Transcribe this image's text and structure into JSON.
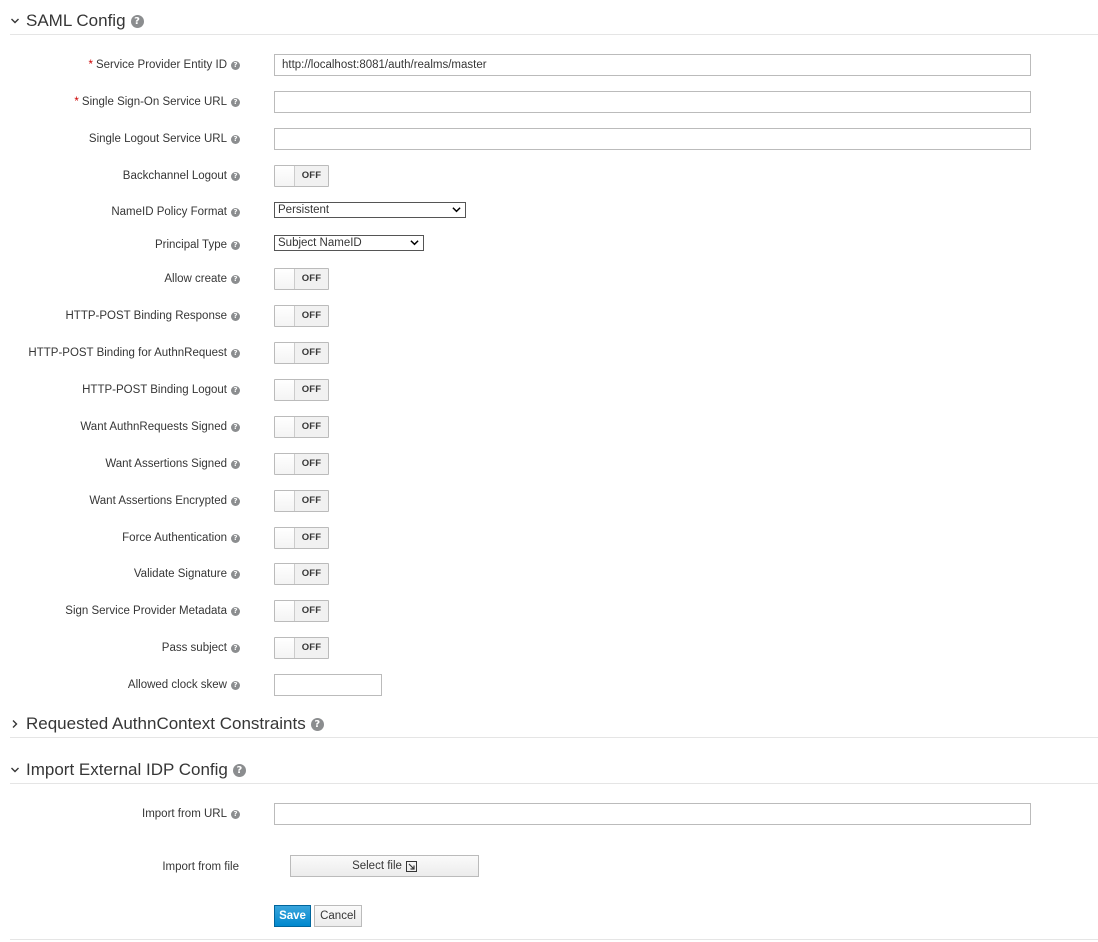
{
  "sections": {
    "saml_config": "SAML Config",
    "requested_authn": "Requested AuthnContext Constraints",
    "import_idp": "Import External IDP Config"
  },
  "fields": {
    "entity_id": {
      "label": "Service Provider Entity ID",
      "value": "http://localhost:8081/auth/realms/master",
      "required": "*"
    },
    "sso_url": {
      "label": "Single Sign-On Service URL",
      "value": "",
      "required": "*"
    },
    "slo_url": {
      "label": "Single Logout Service URL",
      "value": ""
    },
    "backchannel": {
      "label": "Backchannel Logout",
      "state": "OFF"
    },
    "nameid_format": {
      "label": "NameID Policy Format",
      "value": "Persistent"
    },
    "principal_type": {
      "label": "Principal Type",
      "value": "Subject NameID"
    },
    "allow_create": {
      "label": "Allow create",
      "state": "OFF"
    },
    "post_response": {
      "label": "HTTP-POST Binding Response",
      "state": "OFF"
    },
    "post_authn": {
      "label": "HTTP-POST Binding for AuthnRequest",
      "state": "OFF"
    },
    "post_logout": {
      "label": "HTTP-POST Binding Logout",
      "state": "OFF"
    },
    "want_authn_signed": {
      "label": "Want AuthnRequests Signed",
      "state": "OFF"
    },
    "want_assert_signed": {
      "label": "Want Assertions Signed",
      "state": "OFF"
    },
    "want_assert_enc": {
      "label": "Want Assertions Encrypted",
      "state": "OFF"
    },
    "force_auth": {
      "label": "Force Authentication",
      "state": "OFF"
    },
    "validate_sig": {
      "label": "Validate Signature",
      "state": "OFF"
    },
    "sign_metadata": {
      "label": "Sign Service Provider Metadata",
      "state": "OFF"
    },
    "pass_subject": {
      "label": "Pass subject",
      "state": "OFF"
    },
    "clock_skew": {
      "label": "Allowed clock skew",
      "value": ""
    },
    "import_url": {
      "label": "Import from URL",
      "value": ""
    },
    "import_file": {
      "label": "Import from file",
      "button": "Select file"
    }
  },
  "actions": {
    "save": "Save",
    "cancel": "Cancel"
  },
  "colors": {
    "primary": "#0088ce",
    "required": "#cc0000",
    "help": "#8b8d8f"
  }
}
